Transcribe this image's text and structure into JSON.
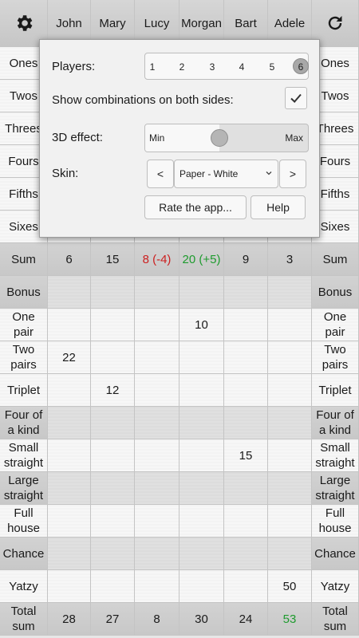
{
  "header": {
    "settings_icon": "gear-icon",
    "refresh_icon": "refresh-icon",
    "players": [
      "John",
      "Mary",
      "Lucy",
      "Morgan",
      "Bart",
      "Adele"
    ]
  },
  "rows": [
    {
      "label": "Ones",
      "right_label": "Ones",
      "values": [
        "",
        "",
        "",
        "",
        "",
        ""
      ]
    },
    {
      "label": "Twos",
      "right_label": "Twos",
      "values": [
        "",
        "",
        "",
        "",
        "",
        ""
      ]
    },
    {
      "label": "Threes",
      "right_label": "Threes",
      "values": [
        "",
        "",
        "",
        "",
        "",
        ""
      ]
    },
    {
      "label": "Fours",
      "right_label": "Fours",
      "values": [
        "",
        "",
        "",
        "",
        "",
        ""
      ]
    },
    {
      "label": "Fifths",
      "right_label": "Fifths",
      "values": [
        "",
        "",
        "",
        "",
        "",
        ""
      ]
    },
    {
      "label": "Sixes",
      "right_label": "Sixes",
      "values": [
        "",
        "",
        "",
        "",
        "",
        ""
      ]
    },
    {
      "label": "Sum",
      "right_label": "Sum",
      "values": [
        "6",
        "15",
        "8 (-4)",
        "20 (+5)",
        "9",
        "3"
      ]
    },
    {
      "label": "Bonus",
      "right_label": "Bonus",
      "values": [
        "",
        "",
        "",
        "",
        "",
        ""
      ]
    },
    {
      "label": "One\npair",
      "right_label": "One\npair",
      "values": [
        "",
        "",
        "",
        "10",
        "",
        ""
      ]
    },
    {
      "label": "Two\npairs",
      "right_label": "Two\npairs",
      "values": [
        "22",
        "",
        "",
        "",
        "",
        ""
      ]
    },
    {
      "label": "Triplet",
      "right_label": "Triplet",
      "values": [
        "",
        "12",
        "",
        "",
        "",
        ""
      ]
    },
    {
      "label": "Four of\na kind",
      "right_label": "Four of\na kind",
      "values": [
        "",
        "",
        "",
        "",
        "",
        ""
      ]
    },
    {
      "label": "Small\nstraight",
      "right_label": "Small\nstraight",
      "values": [
        "",
        "",
        "",
        "",
        "15",
        ""
      ]
    },
    {
      "label": "Large\nstraight",
      "right_label": "Large\nstraight",
      "values": [
        "",
        "",
        "",
        "",
        "",
        ""
      ]
    },
    {
      "label": "Full\nhouse",
      "right_label": "Full\nhouse",
      "values": [
        "",
        "",
        "",
        "",
        "",
        ""
      ]
    },
    {
      "label": "Chance",
      "right_label": "Chance",
      "values": [
        "",
        "",
        "",
        "",
        "",
        ""
      ]
    },
    {
      "label": "Yatzy",
      "right_label": "Yatzy",
      "values": [
        "",
        "",
        "",
        "",
        "",
        "50"
      ]
    },
    {
      "label": "Total\nsum",
      "right_label": "Total\nsum",
      "values": [
        "28",
        "27",
        "8",
        "30",
        "24",
        "53"
      ]
    }
  ],
  "value_colors": {
    "red": "#cc1f1f",
    "green": "#1e9b2e",
    "highlighted": [
      {
        "row": 6,
        "col": 2,
        "color": "red"
      },
      {
        "row": 6,
        "col": 3,
        "color": "green"
      },
      {
        "row": 17,
        "col": 5,
        "color": "green"
      }
    ]
  },
  "settings_dialog": {
    "players_label": "Players:",
    "player_counts": [
      "1",
      "2",
      "3",
      "4",
      "5",
      "6"
    ],
    "players_selected": "6",
    "combinations_label": "Show combinations on both sides:",
    "combinations_checked": true,
    "effect_label": "3D effect:",
    "effect_min": "Min",
    "effect_max": "Max",
    "effect_level": 0.45,
    "skin_label": "Skin:",
    "skin_prev": "<",
    "skin_value": "Paper  - White",
    "skin_next": ">",
    "rate_button": "Rate the app...",
    "help_button": "Help"
  }
}
